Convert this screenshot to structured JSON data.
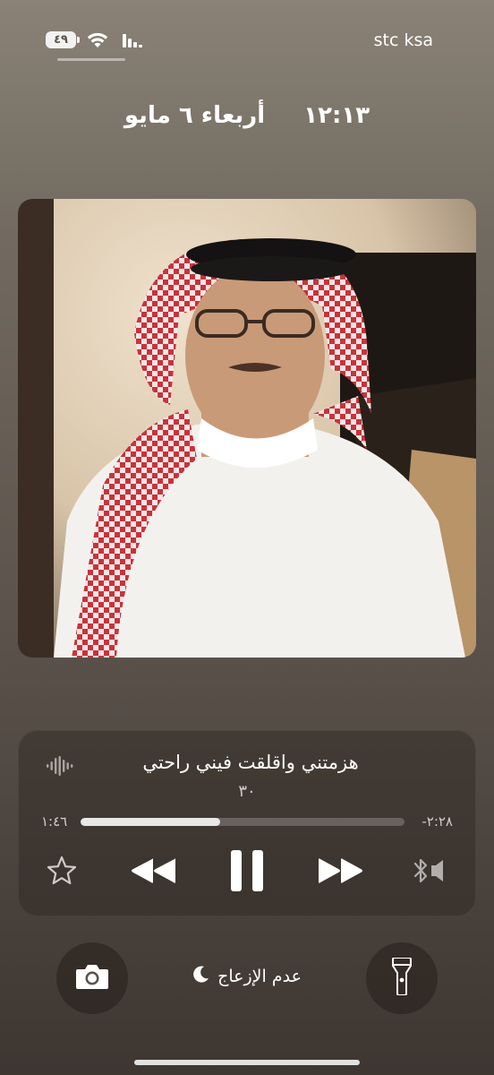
{
  "status_bar": {
    "battery_level": "٤٩",
    "carrier": "stc ksa",
    "wifi_icon": "wifi-icon",
    "signal_icon": "cellular-signal-icon"
  },
  "lock_screen": {
    "time": "١٢:١٣",
    "date": "أربعاء ٦ مايو"
  },
  "artwork": {
    "description_icon": "album-artwork"
  },
  "now_playing": {
    "title": "هزمتني واقلقت فيني راحتي",
    "subtitle": "٣٠",
    "elapsed": "١:٤٦",
    "remaining": "-٢:٢٨",
    "progress_fraction": 0.43,
    "controls": {
      "favorite_icon": "star-icon",
      "rewind_icon": "rewind-icon",
      "pause_icon": "pause-icon",
      "forward_icon": "fast-forward-icon",
      "output_icon": "bluetooth-speaker-icon",
      "waveform_icon": "waveform-icon"
    }
  },
  "bottom_controls": {
    "camera_icon": "camera-icon",
    "flashlight_icon": "flashlight-icon",
    "focus_label": "عدم الإزعاج",
    "focus_icon": "moon-icon"
  }
}
